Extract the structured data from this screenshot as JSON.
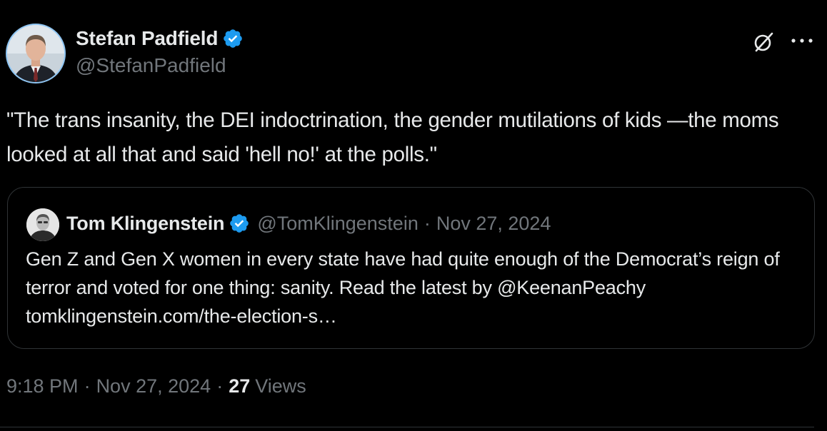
{
  "tweet": {
    "author": {
      "name": "Stefan Padfield",
      "handle": "@StefanPadfield",
      "verified": true
    },
    "text": "\"The trans insanity, the DEI indoctrination, the gender mutilations of kids —the moms looked at all that and said 'hell no!' at the polls.\"",
    "quoted": {
      "author_name": "Tom Klingenstein",
      "author_handle": "@TomKlingenstein",
      "separator": "·",
      "date": "Nov 27, 2024",
      "text": "Gen Z and Gen X women in every state have had quite enough of the Democrat’s reign of terror and voted for one thing: sanity. Read the latest by @KeenanPeachy tomklingenstein.com/the-election-s…"
    },
    "meta": {
      "time": "9:18 PM",
      "date": "Nov 27, 2024",
      "separator": "·",
      "views_count": "27",
      "views_label": "Views"
    }
  },
  "icons": {
    "verified": "verified-badge-icon",
    "grok": "grok-icon",
    "more": "more-options-icon"
  },
  "colors": {
    "background": "#000000",
    "text_primary": "#e7e9ea",
    "text_secondary": "#71767b",
    "border": "#2f3336",
    "verified_blue": "#1d9bf0",
    "avatar_ring": "#8ec5f3"
  }
}
